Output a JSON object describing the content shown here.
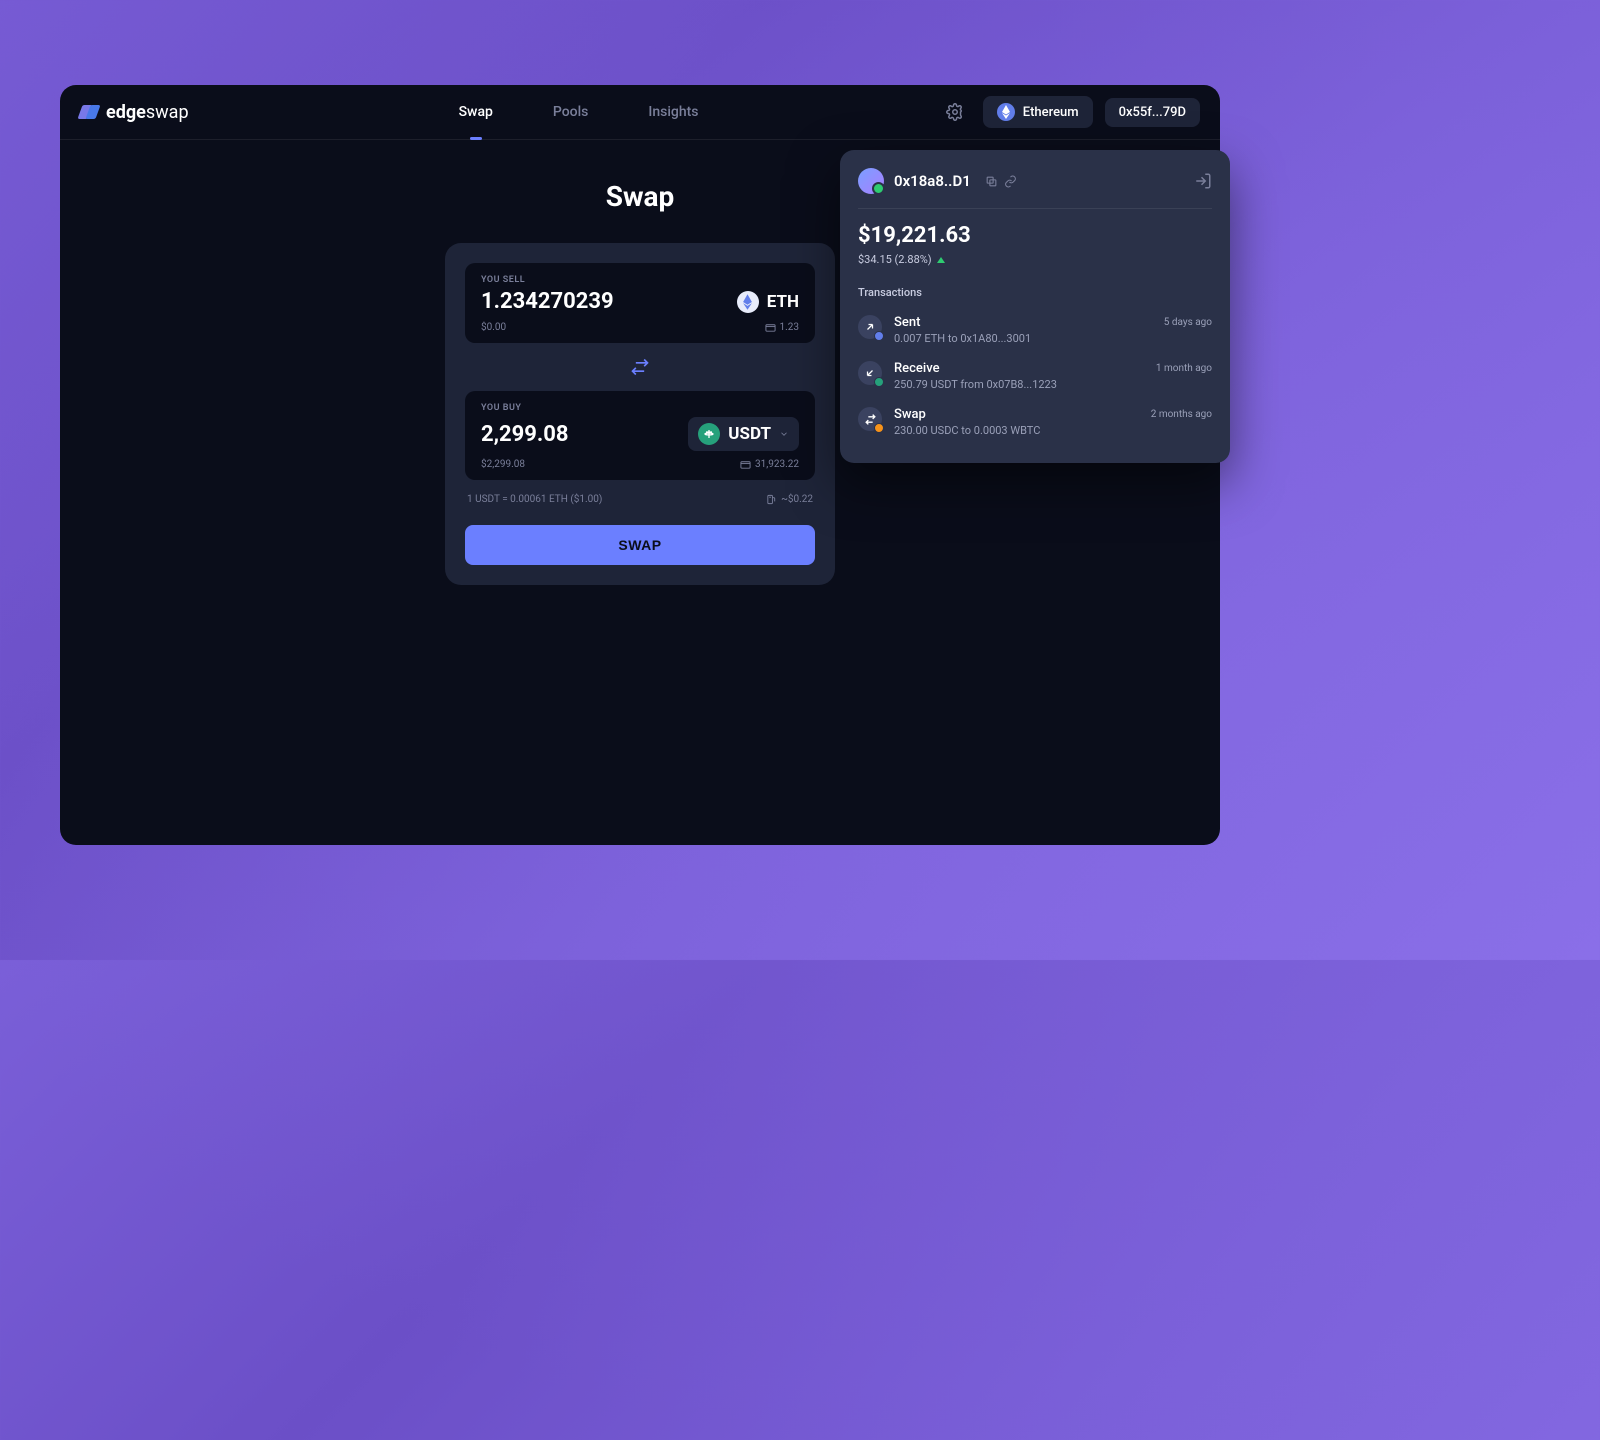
{
  "brand": {
    "name1": "edge",
    "name2": "swap"
  },
  "nav": {
    "items": [
      "Swap",
      "Pools",
      "Insights"
    ],
    "activeIndex": 0
  },
  "topbar": {
    "network": "Ethereum",
    "wallet": "0x55f...79D"
  },
  "page": {
    "title": "Swap"
  },
  "swap": {
    "sell": {
      "label": "YOU SELL",
      "amount": "1.234270239",
      "token": "ETH",
      "usd": "$0.00",
      "balance": "1.23"
    },
    "buy": {
      "label": "YOU BUY",
      "amount": "2,299.08",
      "token": "USDT",
      "usd": "$2,299.08",
      "balance": "31,923.22"
    },
    "rate": "1 USDT = 0.00061 ETH ($1.00)",
    "gas": "~$0.22",
    "button": "SWAP"
  },
  "popover": {
    "address": "0x18a8..D1",
    "balance": "$19,221.63",
    "change": "$34.15 (2.88%)",
    "txTitle": "Transactions",
    "transactions": [
      {
        "type": "Sent",
        "desc": "0.007 ETH to 0x1A80...3001",
        "time": "5 days ago",
        "badge": "#627eea"
      },
      {
        "type": "Receive",
        "desc": "250.79 USDT from 0x07B8...1223",
        "time": "1 month ago",
        "badge": "#26a17b"
      },
      {
        "type": "Swap",
        "desc": "230.00 USDC to 0.0003 WBTC",
        "time": "2 months ago",
        "badge": "#f7931a"
      }
    ]
  }
}
